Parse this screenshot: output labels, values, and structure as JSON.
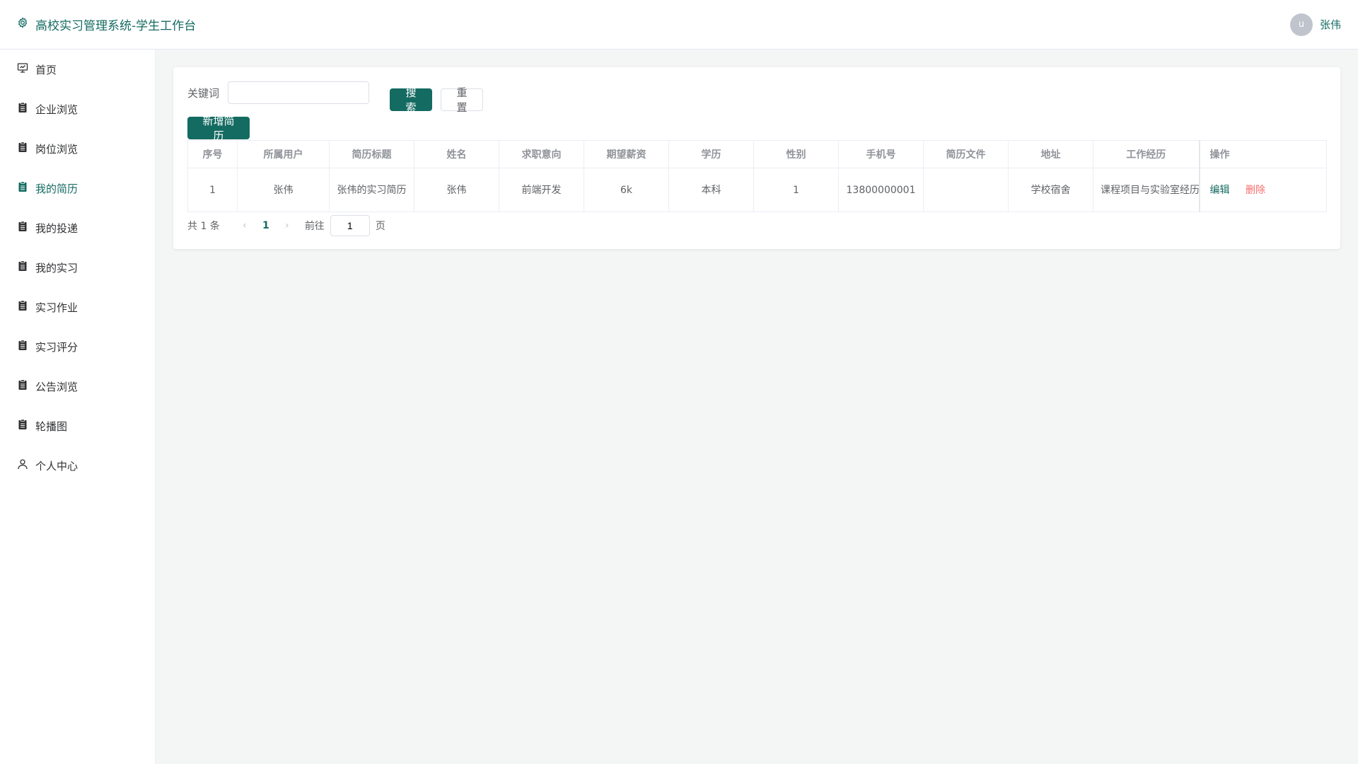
{
  "header": {
    "title": "高校实习管理系统-学生工作台",
    "avatar_letter": "u",
    "username": "张伟"
  },
  "sidebar": {
    "items": [
      {
        "label": "首页",
        "icon": "presentation-icon"
      },
      {
        "label": "企业浏览",
        "icon": "clipboard-icon"
      },
      {
        "label": "岗位浏览",
        "icon": "clipboard-icon"
      },
      {
        "label": "我的简历",
        "icon": "clipboard-icon",
        "active": true
      },
      {
        "label": "我的投递",
        "icon": "clipboard-icon"
      },
      {
        "label": "我的实习",
        "icon": "clipboard-icon"
      },
      {
        "label": "实习作业",
        "icon": "clipboard-icon"
      },
      {
        "label": "实习评分",
        "icon": "clipboard-icon"
      },
      {
        "label": "公告浏览",
        "icon": "clipboard-icon"
      },
      {
        "label": "轮播图",
        "icon": "clipboard-icon"
      },
      {
        "label": "个人中心",
        "icon": "user-icon"
      }
    ]
  },
  "search": {
    "label": "关键词",
    "value": "",
    "search_button": "搜索",
    "reset_button": "重置"
  },
  "actions": {
    "add_button": "新增简历"
  },
  "table": {
    "columns": [
      "序号",
      "所属用户",
      "简历标题",
      "姓名",
      "求职意向",
      "期望薪资",
      "学历",
      "性别",
      "手机号",
      "简历文件",
      "地址",
      "工作经历",
      "操作"
    ],
    "rows": [
      {
        "index": "1",
        "owner": "张伟",
        "title": "张伟的实习简历",
        "name": "张伟",
        "intention": "前端开发",
        "salary": "6k",
        "education": "本科",
        "gender": "1",
        "phone": "13800000001",
        "file": "",
        "address": "学校宿舍",
        "experience": "课程项目与实验室经历",
        "edit": "编辑",
        "delete": "删除"
      }
    ]
  },
  "pagination": {
    "total_text": "共 1 条",
    "current_page": "1",
    "goto_label": "前往",
    "goto_value": "1",
    "page_suffix": "页"
  },
  "colors": {
    "primary": "#146b62",
    "danger": "#f56c6c",
    "background": "#f4f5f5"
  }
}
